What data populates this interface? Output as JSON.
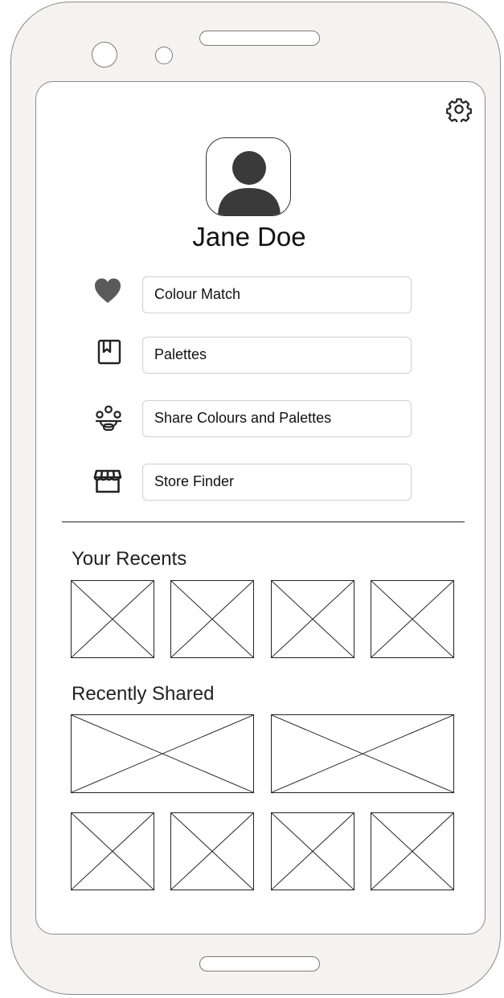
{
  "profile": {
    "name": "Jane Doe"
  },
  "menu": [
    {
      "label": "Colour Match",
      "icon": "heart-icon"
    },
    {
      "label": "Palettes",
      "icon": "bookmark-icon"
    },
    {
      "label": "Share Colours and Palettes",
      "icon": "group-icon"
    },
    {
      "label": "Store Finder",
      "icon": "store-icon"
    }
  ],
  "sections": {
    "recents_title": "Your Recents",
    "shared_title": "Recently Shared"
  },
  "icons": {
    "settings": "gear-icon",
    "avatar": "user-avatar-icon"
  },
  "colors": {
    "frame": "#f5f3f2",
    "icon_gray": "#555555",
    "text": "#111111"
  }
}
